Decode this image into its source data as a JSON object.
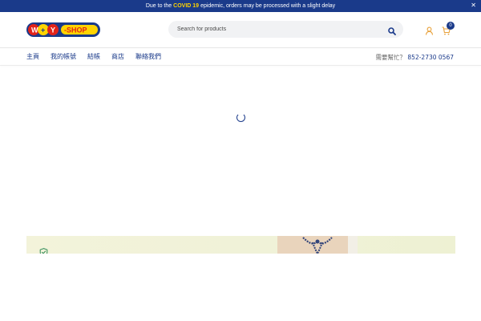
{
  "announcement": {
    "prefix": "Due to the",
    "highlight": "COVID 19",
    "suffix": "epidemic, orders may be processed with a slight delay",
    "close_label": "✕"
  },
  "search": {
    "placeholder": "Search for products"
  },
  "cart": {
    "count": "0"
  },
  "nav": {
    "items": [
      "主頁",
      "我的帳號",
      "結帳",
      "商店",
      "聯絡我們"
    ]
  },
  "help": {
    "label": "需要幫忙？",
    "phone": "852-2730 0567"
  },
  "colors": {
    "brand": "#1a3a8a",
    "highlight": "#ffd400",
    "cart_icon": "#e8a13a"
  },
  "icons": [
    "close-icon",
    "logo",
    "search-icon",
    "account-icon",
    "cart-icon",
    "loading-spinner-icon",
    "shield-check-icon",
    "gift-ribbon-icon"
  ]
}
